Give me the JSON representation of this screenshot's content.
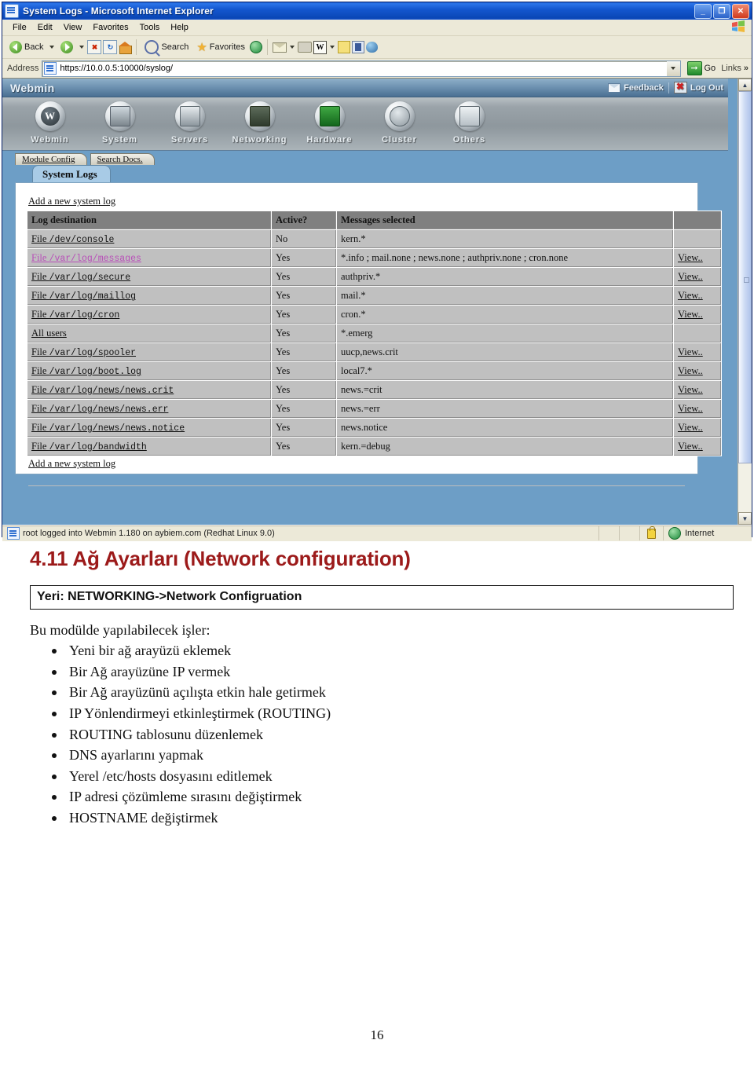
{
  "browser": {
    "title": "System Logs - Microsoft Internet Explorer",
    "window_buttons": {
      "minimize": "_",
      "restore": "❐",
      "close": "✕"
    },
    "menu": [
      "File",
      "Edit",
      "View",
      "Favorites",
      "Tools",
      "Help"
    ],
    "toolbar": {
      "back": "Back",
      "search": "Search",
      "favorites": "Favorites",
      "word_letter": "W"
    },
    "address": {
      "label": "Address",
      "value": "https://10.0.0.5:10000/syslog/",
      "go": "Go",
      "links": "Links",
      "chevron": "»"
    },
    "status": {
      "message": "root logged into Webmin 1.180 on aybiem.com (Redhat Linux 9.0)",
      "zone": "Internet"
    }
  },
  "webmin": {
    "logo": "Webmin",
    "feedback": "Feedback",
    "logout": "Log Out",
    "categories": [
      {
        "label": "Webmin",
        "icon": "webmin-icon",
        "glyph": "W"
      },
      {
        "label": "System",
        "icon": "system-icon",
        "glyph": ""
      },
      {
        "label": "Servers",
        "icon": "servers-icon",
        "glyph": ""
      },
      {
        "label": "Networking",
        "icon": "networking-icon",
        "glyph": ""
      },
      {
        "label": "Hardware",
        "icon": "hardware-icon",
        "glyph": ""
      },
      {
        "label": "Cluster",
        "icon": "cluster-icon",
        "glyph": ""
      },
      {
        "label": "Others",
        "icon": "others-icon",
        "glyph": ""
      }
    ],
    "tabs": [
      "Module Config",
      "Search Docs."
    ],
    "module_tab": "System Logs",
    "add_link_top": "Add a new system log",
    "add_link_bottom": "Add a new system log",
    "table": {
      "headers": [
        "Log destination",
        "Active?",
        "Messages selected",
        ""
      ],
      "rows": [
        {
          "prefix": "File ",
          "path": "/dev/console",
          "visited": false,
          "active": "No",
          "messages": "kern.*",
          "view": ""
        },
        {
          "prefix": "File ",
          "path": "/var/log/messages",
          "visited": true,
          "active": "Yes",
          "messages": "*.info ; mail.none ; news.none ; authpriv.none ; cron.none",
          "view": "View.."
        },
        {
          "prefix": "File ",
          "path": "/var/log/secure",
          "visited": false,
          "active": "Yes",
          "messages": "authpriv.*",
          "view": "View.."
        },
        {
          "prefix": "File ",
          "path": "/var/log/maillog",
          "visited": false,
          "active": "Yes",
          "messages": "mail.*",
          "view": "View.."
        },
        {
          "prefix": "File ",
          "path": "/var/log/cron",
          "visited": false,
          "active": "Yes",
          "messages": "cron.*",
          "view": "View.."
        },
        {
          "prefix": "All users",
          "path": "",
          "visited": false,
          "active": "Yes",
          "messages": "*.emerg",
          "view": ""
        },
        {
          "prefix": "File ",
          "path": "/var/log/spooler",
          "visited": false,
          "active": "Yes",
          "messages": "uucp,news.crit",
          "view": "View.."
        },
        {
          "prefix": "File ",
          "path": "/var/log/boot.log",
          "visited": false,
          "active": "Yes",
          "messages": "local7.*",
          "view": "View.."
        },
        {
          "prefix": "File ",
          "path": "/var/log/news/news.crit",
          "visited": false,
          "active": "Yes",
          "messages": "news.=crit",
          "view": "View.."
        },
        {
          "prefix": "File ",
          "path": "/var/log/news/news.err",
          "visited": false,
          "active": "Yes",
          "messages": "news.=err",
          "view": "View.."
        },
        {
          "prefix": "File ",
          "path": "/var/log/news/news.notice",
          "visited": false,
          "active": "Yes",
          "messages": "news.notice",
          "view": "View.."
        },
        {
          "prefix": "File ",
          "path": "/var/log/bandwidth",
          "visited": false,
          "active": "Yes",
          "messages": "kern.=debug",
          "view": "View.."
        }
      ]
    }
  },
  "document": {
    "heading": "4.11 Ağ Ayarları (Network configuration)",
    "heading_color": "#9c1a1a",
    "location_line": "Yeri: NETWORKING->Network Configruation",
    "intro": "Bu modülde yapılabilecek işler:",
    "bullets": [
      "Yeni bir ağ arayüzü eklemek",
      "Bir Ağ arayüzüne IP vermek",
      "Bir Ağ arayüzünü açılışta etkin hale getirmek",
      "IP Yönlendirmeyi etkinleştirmek (ROUTING)",
      "ROUTING tablosunu düzenlemek",
      "DNS ayarlarını yapmak",
      "Yerel /etc/hosts dosyasını editlemek",
      "IP adresi çözümleme sırasını değiştirmek",
      "HOSTNAME değiştirmek"
    ],
    "page_number": "16"
  }
}
